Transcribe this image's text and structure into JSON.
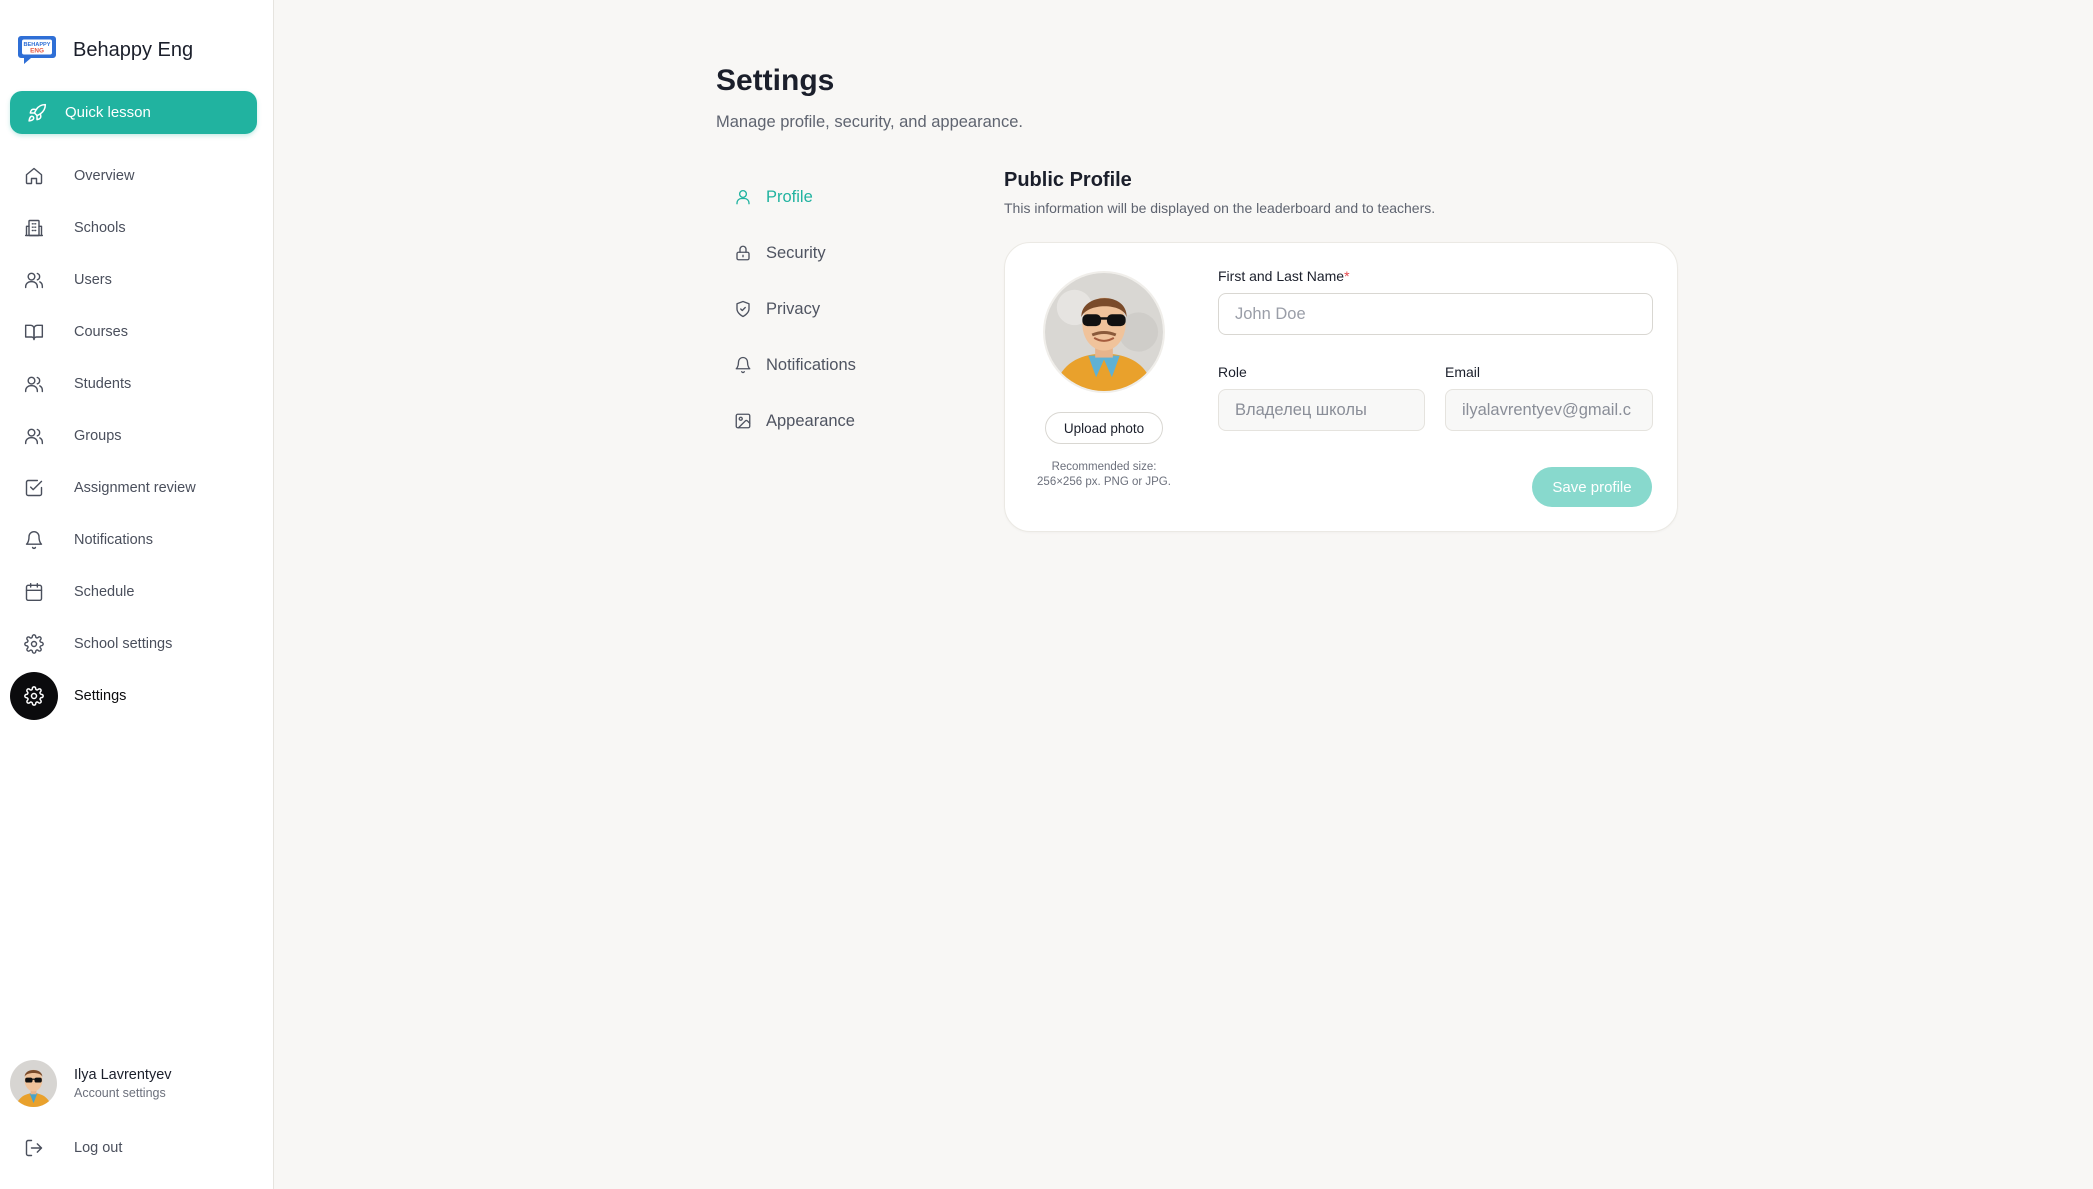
{
  "brand": {
    "name": "Behappy Eng",
    "logo_text_top": "BEHAPPY",
    "logo_text_bottom": "ENG"
  },
  "sidebar": {
    "quick_lesson": "Quick lesson",
    "items": [
      {
        "label": "Overview",
        "icon": "home-icon"
      },
      {
        "label": "Schools",
        "icon": "building-icon"
      },
      {
        "label": "Users",
        "icon": "users-icon"
      },
      {
        "label": "Courses",
        "icon": "book-icon"
      },
      {
        "label": "Students",
        "icon": "users-icon"
      },
      {
        "label": "Groups",
        "icon": "users-icon"
      },
      {
        "label": "Assignment review",
        "icon": "checkbox-icon"
      },
      {
        "label": "Notifications",
        "icon": "bell-icon"
      },
      {
        "label": "Schedule",
        "icon": "calendar-icon"
      },
      {
        "label": "School settings",
        "icon": "gear-icon"
      },
      {
        "label": "Settings",
        "icon": "gear-icon",
        "active": true
      }
    ],
    "user": {
      "name": "Ilya Lavrentyev",
      "subtitle": "Account settings"
    },
    "logout": "Log out"
  },
  "page": {
    "title": "Settings",
    "subtitle": "Manage profile, security, and appearance."
  },
  "subnav": [
    {
      "label": "Profile",
      "icon": "user-icon",
      "active": true
    },
    {
      "label": "Security",
      "icon": "lock-icon"
    },
    {
      "label": "Privacy",
      "icon": "shield-icon"
    },
    {
      "label": "Notifications",
      "icon": "bell-icon"
    },
    {
      "label": "Appearance",
      "icon": "image-icon"
    }
  ],
  "profile": {
    "title": "Public Profile",
    "subtitle": "This information will be displayed on the leaderboard and to teachers.",
    "upload_label": "Upload photo",
    "upload_hint_1": "Recommended size:",
    "upload_hint_2": "256×256 px. PNG or JPG.",
    "name_label": "First and Last Name",
    "name_required": "*",
    "name_placeholder": "John Doe",
    "name_value": "",
    "role_label": "Role",
    "role_value": "Владелец школы",
    "email_label": "Email",
    "email_value": "ilyalavrentyev@gmail.c",
    "save_label": "Save profile"
  },
  "colors": {
    "accent": "#21b3a0",
    "accent_disabled": "#88d9cd",
    "active_nav_bg": "#0b0b0d",
    "page_bg": "#f8f7f5"
  }
}
